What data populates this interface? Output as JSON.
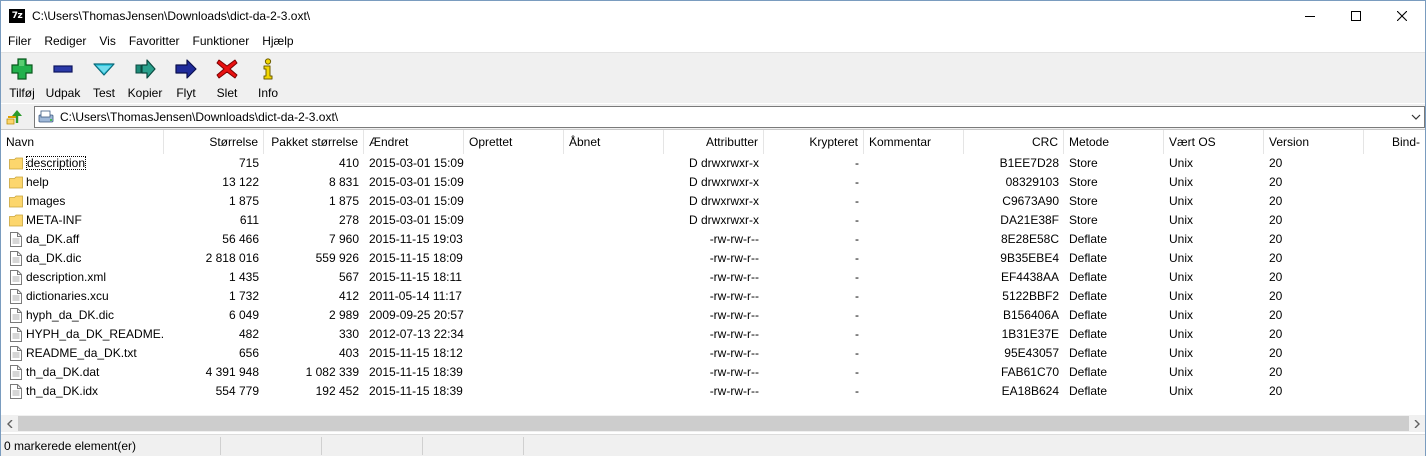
{
  "window": {
    "title": "C:\\Users\\ThomasJensen\\Downloads\\dict-da-2-3.oxt\\",
    "app_icon_text": "7z"
  },
  "menu": [
    "Filer",
    "Rediger",
    "Vis",
    "Favoritter",
    "Funktioner",
    "Hjælp"
  ],
  "toolbar": {
    "add": "Tilføj",
    "extract": "Udpak",
    "test": "Test",
    "copy": "Kopier",
    "move": "Flyt",
    "delete": "Slet",
    "info": "Info"
  },
  "address": {
    "path": "C:\\Users\\ThomasJensen\\Downloads\\dict-da-2-3.oxt\\"
  },
  "columns": [
    "Navn",
    "Størrelse",
    "Pakket størrelse",
    "Ændret",
    "Oprettet",
    "Åbnet",
    "Attributter",
    "Krypteret",
    "Kommentar",
    "CRC",
    "Metode",
    "Vært OS",
    "Version",
    "Bind-"
  ],
  "files": [
    {
      "type": "folder",
      "name": "description",
      "size": "715",
      "packed": "410",
      "modified": "2015-03-01 15:09",
      "created": "",
      "accessed": "",
      "attributes": "D drwxrwxr-x",
      "encrypted": "-",
      "comment": "",
      "crc": "B1EE7D28",
      "method": "Store",
      "host_os": "Unix",
      "version": "20"
    },
    {
      "type": "folder",
      "name": "help",
      "size": "13 122",
      "packed": "8 831",
      "modified": "2015-03-01 15:09",
      "created": "",
      "accessed": "",
      "attributes": "D drwxrwxr-x",
      "encrypted": "-",
      "comment": "",
      "crc": "08329103",
      "method": "Store",
      "host_os": "Unix",
      "version": "20"
    },
    {
      "type": "folder",
      "name": "Images",
      "size": "1 875",
      "packed": "1 875",
      "modified": "2015-03-01 15:09",
      "created": "",
      "accessed": "",
      "attributes": "D drwxrwxr-x",
      "encrypted": "-",
      "comment": "",
      "crc": "C9673A90",
      "method": "Store",
      "host_os": "Unix",
      "version": "20"
    },
    {
      "type": "folder",
      "name": "META-INF",
      "size": "611",
      "packed": "278",
      "modified": "2015-03-01 15:09",
      "created": "",
      "accessed": "",
      "attributes": "D drwxrwxr-x",
      "encrypted": "-",
      "comment": "",
      "crc": "DA21E38F",
      "method": "Store",
      "host_os": "Unix",
      "version": "20"
    },
    {
      "type": "file",
      "name": "da_DK.aff",
      "size": "56 466",
      "packed": "7 960",
      "modified": "2015-11-15 19:03",
      "created": "",
      "accessed": "",
      "attributes": "-rw-rw-r--",
      "encrypted": "-",
      "comment": "",
      "crc": "8E28E58C",
      "method": "Deflate",
      "host_os": "Unix",
      "version": "20"
    },
    {
      "type": "file",
      "name": "da_DK.dic",
      "size": "2 818 016",
      "packed": "559 926",
      "modified": "2015-11-15 18:09",
      "created": "",
      "accessed": "",
      "attributes": "-rw-rw-r--",
      "encrypted": "-",
      "comment": "",
      "crc": "9B35EBE4",
      "method": "Deflate",
      "host_os": "Unix",
      "version": "20"
    },
    {
      "type": "file",
      "name": "description.xml",
      "size": "1 435",
      "packed": "567",
      "modified": "2015-11-15 18:11",
      "created": "",
      "accessed": "",
      "attributes": "-rw-rw-r--",
      "encrypted": "-",
      "comment": "",
      "crc": "EF4438AA",
      "method": "Deflate",
      "host_os": "Unix",
      "version": "20"
    },
    {
      "type": "file",
      "name": "dictionaries.xcu",
      "size": "1 732",
      "packed": "412",
      "modified": "2011-05-14 11:17",
      "created": "",
      "accessed": "",
      "attributes": "-rw-rw-r--",
      "encrypted": "-",
      "comment": "",
      "crc": "5122BBF2",
      "method": "Deflate",
      "host_os": "Unix",
      "version": "20"
    },
    {
      "type": "file",
      "name": "hyph_da_DK.dic",
      "size": "6 049",
      "packed": "2 989",
      "modified": "2009-09-25 20:57",
      "created": "",
      "accessed": "",
      "attributes": "-rw-rw-r--",
      "encrypted": "-",
      "comment": "",
      "crc": "B156406A",
      "method": "Deflate",
      "host_os": "Unix",
      "version": "20"
    },
    {
      "type": "file",
      "name": "HYPH_da_DK_README....",
      "size": "482",
      "packed": "330",
      "modified": "2012-07-13 22:34",
      "created": "",
      "accessed": "",
      "attributes": "-rw-rw-r--",
      "encrypted": "-",
      "comment": "",
      "crc": "1B31E37E",
      "method": "Deflate",
      "host_os": "Unix",
      "version": "20"
    },
    {
      "type": "file",
      "name": "README_da_DK.txt",
      "size": "656",
      "packed": "403",
      "modified": "2015-11-15 18:12",
      "created": "",
      "accessed": "",
      "attributes": "-rw-rw-r--",
      "encrypted": "-",
      "comment": "",
      "crc": "95E43057",
      "method": "Deflate",
      "host_os": "Unix",
      "version": "20"
    },
    {
      "type": "file",
      "name": "th_da_DK.dat",
      "size": "4 391 948",
      "packed": "1 082 339",
      "modified": "2015-11-15 18:39",
      "created": "",
      "accessed": "",
      "attributes": "-rw-rw-r--",
      "encrypted": "-",
      "comment": "",
      "crc": "FAB61C70",
      "method": "Deflate",
      "host_os": "Unix",
      "version": "20"
    },
    {
      "type": "file",
      "name": "th_da_DK.idx",
      "size": "554 779",
      "packed": "192 452",
      "modified": "2015-11-15 18:39",
      "created": "",
      "accessed": "",
      "attributes": "-rw-rw-r--",
      "encrypted": "-",
      "comment": "",
      "crc": "EA18B624",
      "method": "Deflate",
      "host_os": "Unix",
      "version": "20"
    }
  ],
  "status": {
    "selected": "0 markerede element(er)"
  },
  "colors": {
    "folder": "#fcd66d",
    "add_green": "#22b14c",
    "extract_blue": "#2b3aa8",
    "test_cyan": "#32c8e0",
    "delete_red": "#e81010",
    "info_yellow": "#f2d600"
  }
}
